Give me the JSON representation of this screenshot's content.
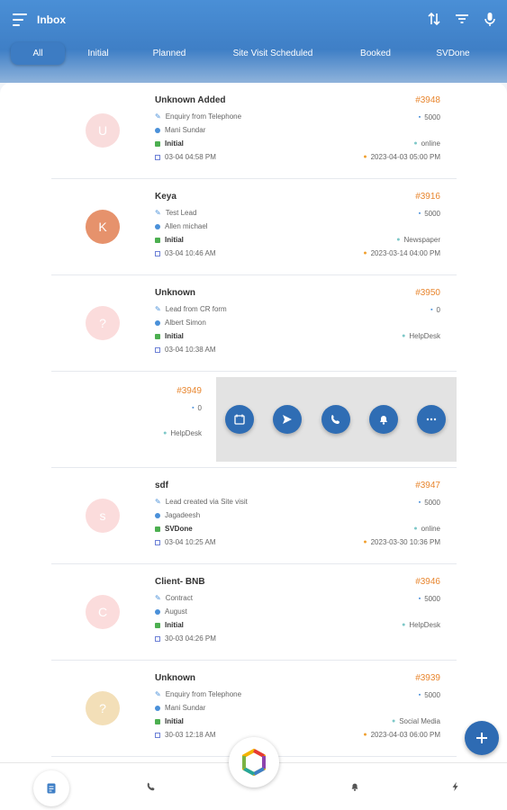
{
  "header": {
    "title": "Inbox"
  },
  "tabs": [
    {
      "label": "All"
    },
    {
      "label": "Initial"
    },
    {
      "label": "Planned"
    },
    {
      "label": "Site Visit Scheduled"
    },
    {
      "label": "Booked"
    },
    {
      "label": "SVDone"
    }
  ],
  "leads": [
    {
      "initial": "U",
      "name": "Unknown Added",
      "description": "Enquiry from Telephone",
      "owner": "Mani Sundar",
      "status": "Initial",
      "created": "03-04 04:58 PM",
      "id": "#3948",
      "amount": "5000",
      "source": "online",
      "followup": "2023-04-03 05:00 PM",
      "avatar_color": "#f9dcdc"
    },
    {
      "initial": "K",
      "name": "Keya",
      "description": "Test Lead",
      "owner": "Allen michael",
      "status": "Initial",
      "created": "03-04 10:46 AM",
      "id": "#3916",
      "amount": "5000",
      "source": "Newspaper",
      "followup": "2023-03-14 04:00 PM",
      "avatar_color": "#e6926c"
    },
    {
      "initial": "?",
      "name": "Unknown",
      "description": "Lead from CR form",
      "owner": "Albert Simon",
      "status": "Initial",
      "created": "03-04 10:38 AM",
      "id": "#3950",
      "amount": "0",
      "source": "HelpDesk",
      "followup": "",
      "avatar_color": "#fbdcdc"
    },
    {
      "id": "#3949",
      "amount": "0",
      "source": "HelpDesk"
    },
    {
      "initial": "s",
      "name": "sdf",
      "description": "Lead created via Site visit",
      "owner": "Jagadeesh",
      "status": "SVDone",
      "created": "03-04 10:25 AM",
      "id": "#3947",
      "amount": "5000",
      "source": "online",
      "followup": "2023-03-30 10:36 PM",
      "avatar_color": "#fbdcdc"
    },
    {
      "initial": "C",
      "name": "Client- BNB",
      "description": "Contract",
      "owner": "August",
      "status": "Initial",
      "created": "30-03 04:26 PM",
      "id": "#3946",
      "amount": "5000",
      "source": "HelpDesk",
      "followup": "",
      "avatar_color": "#fbdcdc"
    },
    {
      "initial": "?",
      "name": "Unknown",
      "description": "Enquiry from Telephone",
      "owner": "Mani Sundar",
      "status": "Initial",
      "created": "30-03 12:18 AM",
      "id": "#3939",
      "amount": "5000",
      "source": "Social Media",
      "followup": "2023-04-03 06:00 PM",
      "avatar_color": "#f3dfb8"
    }
  ],
  "colors": {
    "primary": "#3f7fc6",
    "accent": "#e8862f",
    "fab": "#2e6bb3"
  }
}
